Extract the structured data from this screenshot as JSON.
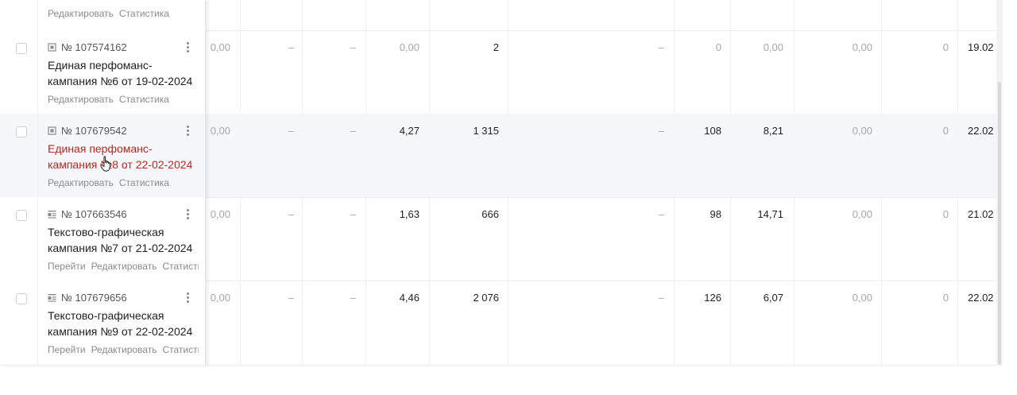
{
  "top_row": {
    "links": [
      "Редактировать",
      "Статистика"
    ]
  },
  "rows": [
    {
      "id": "№ 107574162",
      "type_icon": "performance-campaign-icon",
      "name": "Единая перфоманс-кампания №6 от 19-02-2024",
      "links": [
        "Редактировать",
        "Статистика"
      ],
      "values": [
        "0,00",
        "–",
        "–",
        "0,00",
        "2",
        "–",
        "0",
        "0,00",
        "0,00",
        "0",
        "19.02"
      ]
    },
    {
      "id": "№ 107679542",
      "type_icon": "performance-campaign-icon",
      "name": "Единая перфоманс-кампания №8 от 22-02-2024",
      "links": [
        "Редактировать",
        "Статистика"
      ],
      "values": [
        "0,00",
        "–",
        "–",
        "4,27",
        "1 315",
        "–",
        "108",
        "8,21",
        "0,00",
        "0",
        "22.02"
      ]
    },
    {
      "id": "№ 107663546",
      "type_icon": "text-graphic-campaign-icon",
      "name": "Текстово-графическая кампания №7 от 21-02-2024",
      "links": [
        "Перейти",
        "Редактировать",
        "Статистика"
      ],
      "values": [
        "0,00",
        "–",
        "–",
        "1,63",
        "666",
        "–",
        "98",
        "14,71",
        "0,00",
        "0",
        "21.02"
      ]
    },
    {
      "id": "№ 107679656",
      "type_icon": "text-graphic-campaign-icon",
      "name": "Текстово-графическая кампания №9 от 22-02-2024",
      "links": [
        "Перейти",
        "Редактировать",
        "Статистика"
      ],
      "values": [
        "0,00",
        "–",
        "–",
        "4,46",
        "2 076",
        "–",
        "126",
        "6,07",
        "0,00",
        "0",
        "22.02"
      ]
    }
  ],
  "colors": {
    "accent_red": "#c4231f",
    "hover_row": "#f5f7fa",
    "muted_text": "#a6a6a6"
  }
}
